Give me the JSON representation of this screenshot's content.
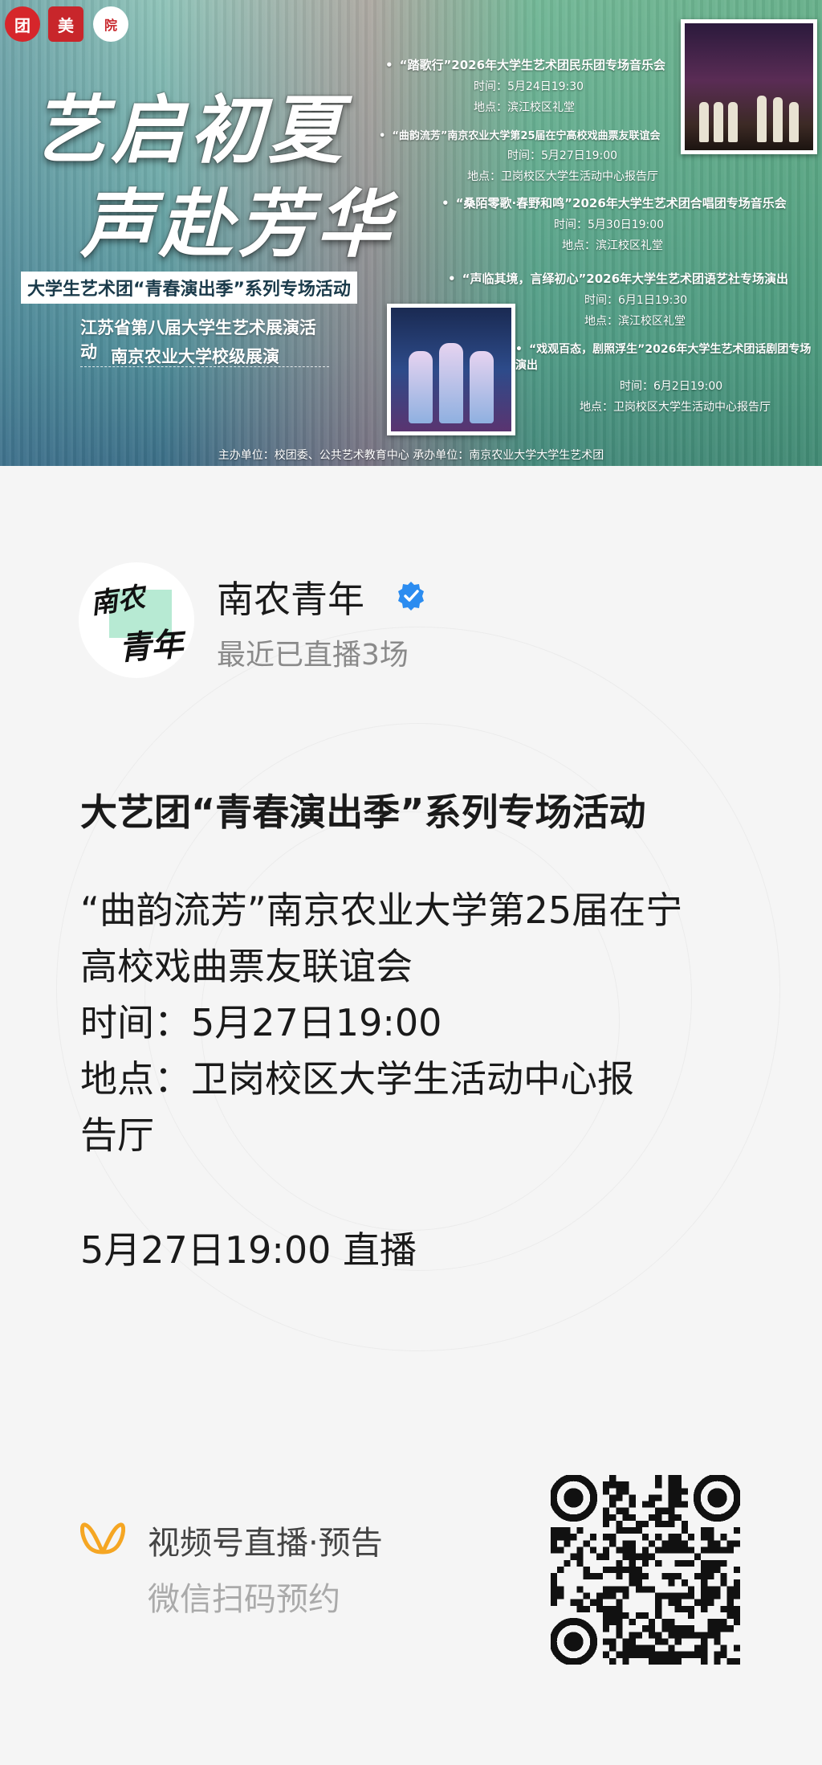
{
  "banner": {
    "logos": [
      "团",
      "美",
      "院"
    ],
    "title_line1": "艺启初夏",
    "title_line2": "声赴芳华",
    "subtitle_box": "大学生艺术团“青春演出季”系列专场活动",
    "line1": "江苏省第八届大学生艺术展演活动",
    "line2": "南京农业大学校级展演",
    "events": [
      {
        "title": "“踏歌行”2026年大学生艺术团民乐团专场音乐会",
        "time": "时间：5月24日19:30",
        "place": "地点：滨江校区礼堂"
      },
      {
        "title": "“曲韵流芳”南京农业大学第25届在宁高校戏曲票友联谊会",
        "time": "时间：5月27日19:00",
        "place": "地点：卫岗校区大学生活动中心报告厅"
      },
      {
        "title": "“桑陌零歌·春野和鸣”2026年大学生艺术团合唱团专场音乐会",
        "time": "时间：5月30日19:00",
        "place": "地点：滨江校区礼堂"
      },
      {
        "title": "“声临其境，言绎初心”2026年大学生艺术团语艺社专场演出",
        "time": "时间：6月1日19:30",
        "place": "地点：滨江校区礼堂"
      },
      {
        "title": "“戏观百态，剧照浮生”2026年大学生艺术团话剧团专场演出",
        "time": "时间：6月2日19:00",
        "place": "地点：卫岗校区大学生活动中心报告厅"
      }
    ],
    "footer": "主办单位：校团委、公共艺术教育中心  承办单位：南京农业大学大学生艺术团"
  },
  "account": {
    "avatar_text_1": "南农",
    "avatar_text_2": "青年",
    "name": "南农青年",
    "subtitle": "最近已直播3场"
  },
  "post": {
    "title": "大艺团“青春演出季”系列专场活动",
    "desc_lines": [
      "“曲韵流芳”南京农业大学第25届在宁",
      "高校戏曲票友联谊会",
      "时间：5月27日19:00",
      "地点：卫岗校区大学生活动中心报",
      "告厅"
    ],
    "live_time": "5月27日19:00 直播"
  },
  "footer": {
    "channel_label": "视频号直播·预告",
    "scan_hint": "微信扫码预约",
    "icon": "channels-butterfly-icon",
    "accent": "#f5a623"
  }
}
